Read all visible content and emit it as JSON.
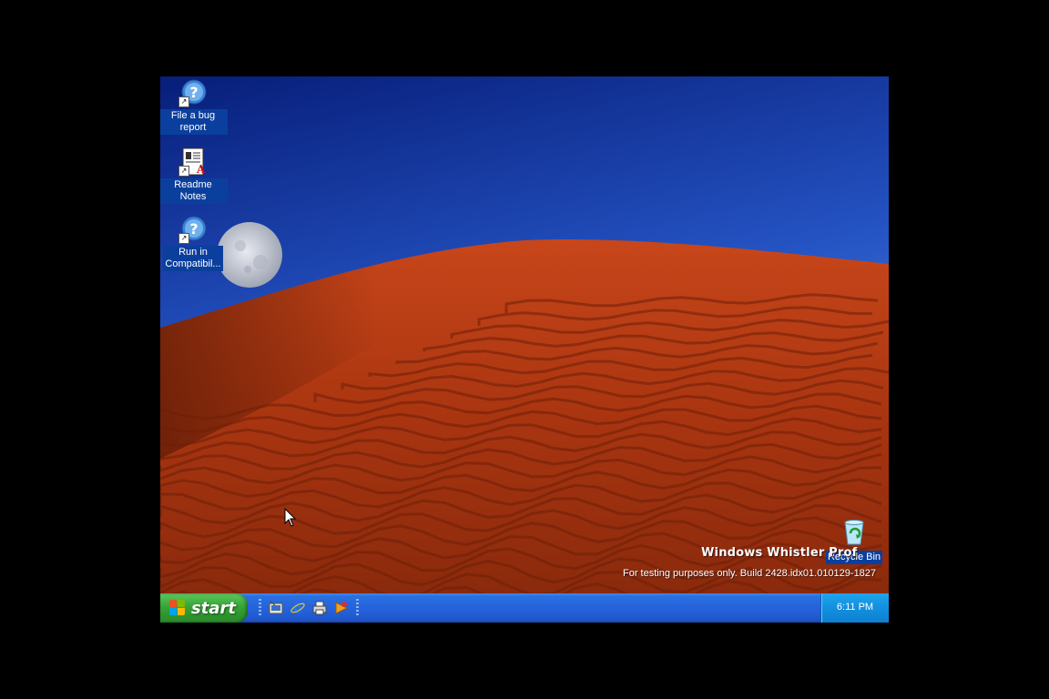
{
  "desktop": {
    "icons": [
      {
        "label": "File a bug report",
        "icon": "help-shortcut-icon"
      },
      {
        "label": "Readme Notes",
        "icon": "document-shortcut-icon"
      },
      {
        "label": "Run in Compatibil...",
        "icon": "help-shortcut-icon"
      },
      {
        "label": "Recycle Bin",
        "icon": "recycle-bin-icon"
      }
    ],
    "branding": {
      "title": "Windows Whistler Prof",
      "build": "For testing purposes only. Build 2428.idx01.010129-1827"
    }
  },
  "taskbar": {
    "start_label": "start",
    "quick_launch": [
      "show-desktop-icon",
      "internet-explorer-icon",
      "printer-icon",
      "media-player-icon"
    ],
    "clock": "6:11 PM"
  },
  "colors": {
    "sky_top": "#0a2f9c",
    "sky_bottom": "#3f78d8",
    "dune": "#b43a14",
    "taskbar_blue": "#2563dc",
    "start_green": "#3aa83a",
    "tray_blue": "#1290e0"
  }
}
